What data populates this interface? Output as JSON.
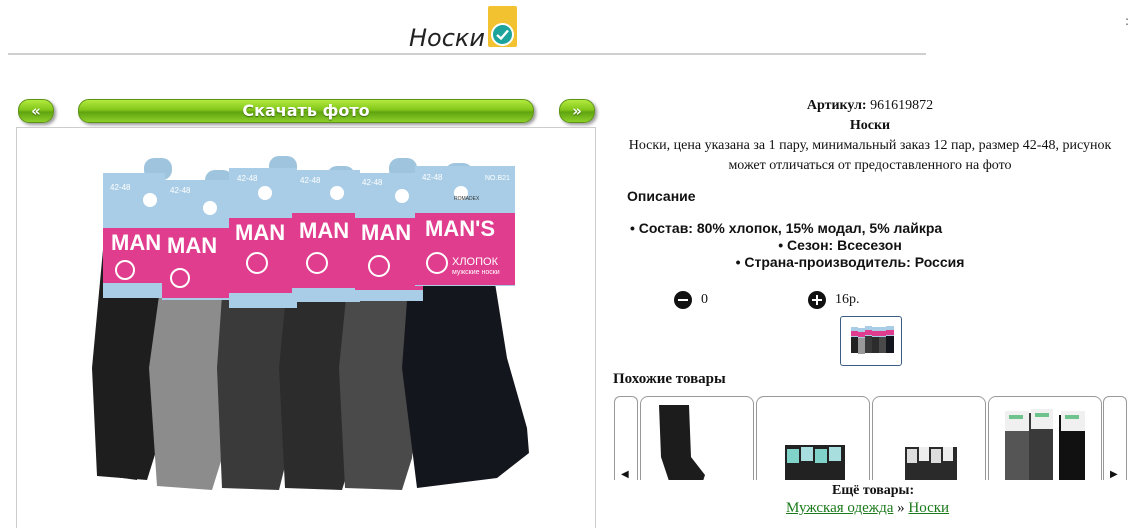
{
  "header": {
    "title": "Носки",
    "badge_icon": "verified-check-icon"
  },
  "gallery": {
    "prev_label": "«",
    "next_label": "»",
    "download_label": "Скачать фото",
    "photo": {
      "tag_size": "42-48",
      "tag_code": "NO.B21",
      "brand": "MAN'S",
      "brand_short": "MAN",
      "material": "ХЛОПОК",
      "subtitle": "мужские носки",
      "maker": "ROMADEX"
    }
  },
  "product": {
    "sku_label": "Артикул:",
    "sku": "961619872",
    "name": "Носки",
    "description": "Носки, цена указана за 1 пару, минимальный заказ 12 пар, размер 42-48, рисунок может отличаться от предоставленного на фото",
    "desc_heading": "Описание",
    "attributes": [
      "Состав: 80% хлопок, 15% модал, 5% лайкра",
      "Сезон: Всесезон",
      "Страна-производитель: Россия"
    ],
    "quantity": "0",
    "price": "16р."
  },
  "similar": {
    "heading": "Похожие товары",
    "left_arrow": "◀",
    "right_arrow": "▶"
  },
  "footer": {
    "more_label": "Ещё товары:",
    "crumb_1": "Мужская одежда",
    "separator": " » ",
    "crumb_2": "Носки"
  },
  "colors": {
    "button_green": "#83c61b",
    "link_green": "#1b7a1b",
    "badge_yellow": "#f2c230",
    "badge_teal": "#1ba39c"
  }
}
